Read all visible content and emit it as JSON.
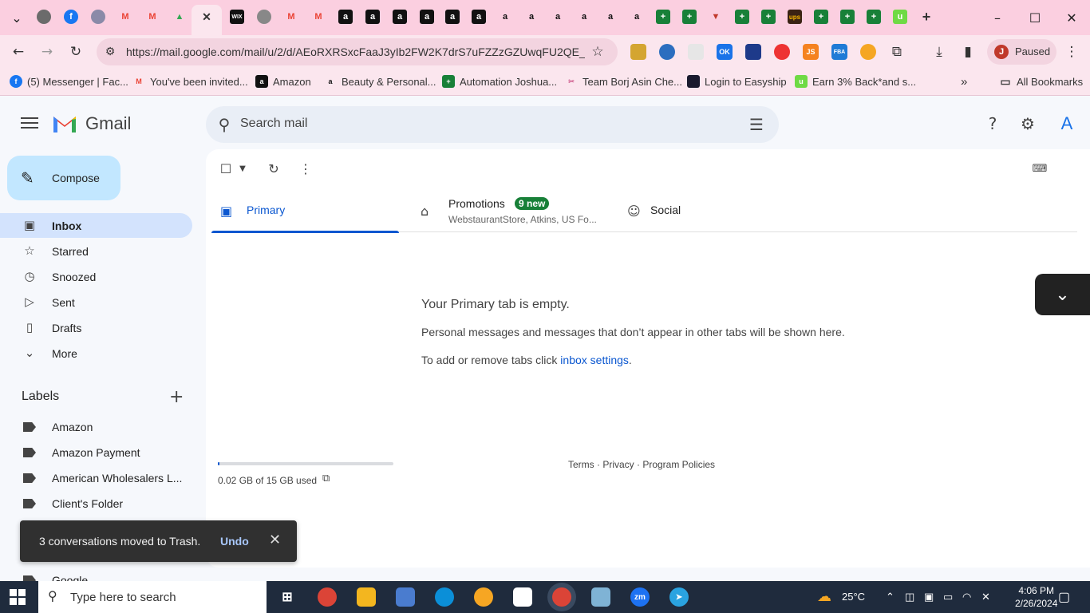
{
  "browser": {
    "tab_icons": [
      "chrome-icon",
      "facebook-icon",
      "web-icon",
      "gmail-icon",
      "gmail-icon",
      "drive-icon",
      "gmail-icon-active",
      "wix-icon",
      "globe-icon",
      "gmail-icon",
      "gmail-icon",
      "amazon-icon",
      "amazon-icon",
      "amazon-icon",
      "amazon-icon",
      "amazon-icon",
      "amazon-icon",
      "amazon-icon",
      "amazon-icon",
      "amazon-icon",
      "amazon-icon",
      "amazon-icon",
      "sheets-icon",
      "sheets-icon",
      "dropdown-icon",
      "sheets-icon",
      "sheets-icon",
      "ups-icon",
      "sheets-icon",
      "sheets-icon",
      "sheets-icon",
      "upwork-icon"
    ],
    "wix_label": "WIX",
    "ups_label": "ups",
    "url": "https://mail.google.com/mail/u/2/d/AEoRXRSxcFaaJ3yIb2FW2K7drS7uFZZzGZUwqFU2QE_I...",
    "profile_initial": "J",
    "profile_status": "Paused",
    "ext_labels": {
      "ok": "OK",
      "js": "JS",
      "fba": "FBA"
    },
    "bookmarks": [
      {
        "label": "(5) Messenger | Fac...",
        "icon": "facebook-icon",
        "color": "#1877f2"
      },
      {
        "label": "You've been invited...",
        "icon": "gmail-icon",
        "color": "#ea4335"
      },
      {
        "label": "Amazon",
        "icon": "amazon-icon",
        "color": "#111111"
      },
      {
        "label": "Beauty & Personal...",
        "icon": "amazon-icon",
        "color": "#111111"
      },
      {
        "label": "Automation Joshua...",
        "icon": "sheets-icon",
        "color": "#188038"
      },
      {
        "label": "Team Borj Asin Che...",
        "icon": "tool-icon",
        "color": "#d06090"
      },
      {
        "label": "Login to Easyship",
        "icon": "easyship-icon",
        "color": "#1a1a2e"
      },
      {
        "label": "Earn 3% Back*and s...",
        "icon": "upwork-icon",
        "color": "#6fda44"
      }
    ],
    "all_bookmarks": "All Bookmarks"
  },
  "gmail": {
    "app_name": "Gmail",
    "search_placeholder": "Search mail",
    "account_initial": "A",
    "compose": "Compose",
    "nav": [
      {
        "label": "Inbox",
        "icon": "inbox-icon",
        "active": true
      },
      {
        "label": "Starred",
        "icon": "star-icon"
      },
      {
        "label": "Snoozed",
        "icon": "clock-icon"
      },
      {
        "label": "Sent",
        "icon": "send-icon"
      },
      {
        "label": "Drafts",
        "icon": "draft-icon"
      },
      {
        "label": "More",
        "icon": "chevron-down-icon"
      }
    ],
    "labels_title": "Labels",
    "labels": [
      "Amazon",
      "Amazon Payment",
      "American Wholesalers L...",
      "Client's Folder",
      "Google"
    ],
    "tabs": [
      {
        "label": "Primary",
        "icon": "inbox-icon",
        "active": true
      },
      {
        "label": "Promotions",
        "icon": "tag-icon",
        "badge": "9 new",
        "subtitle": "WebstaurantStore, Atkins, US Fo..."
      },
      {
        "label": "Social",
        "icon": "people-icon"
      }
    ],
    "empty": {
      "title": "Your Primary tab is empty.",
      "desc": "Personal messages and messages that don’t appear in other tabs will be shown here.",
      "hint_prefix": "To add or remove tabs click ",
      "hint_link": "inbox settings",
      "hint_suffix": "."
    },
    "storage": {
      "text": "0.02 GB of 15 GB used",
      "fraction": 0.0013
    },
    "footer": "Terms · Privacy · Program Policies",
    "toast": {
      "message": "3 conversations moved to Trash.",
      "action": "Undo"
    }
  },
  "taskbar": {
    "search_placeholder": "Type here to search",
    "apps": [
      {
        "name": "task-view-icon",
        "color": "#1f2b3d"
      },
      {
        "name": "chrome-icon",
        "color": "#db4437"
      },
      {
        "name": "file-explorer-icon",
        "color": "#f3b61f"
      },
      {
        "name": "control-panel-icon",
        "color": "#4a7ccf"
      },
      {
        "name": "edge-icon",
        "color": "#0b8fd8"
      },
      {
        "name": "brave-icon",
        "color": "#f6a623"
      },
      {
        "name": "notepad-icon",
        "color": "#ffffff"
      },
      {
        "name": "chrome-active-icon",
        "color": "#db4437"
      },
      {
        "name": "note-icon",
        "color": "#7fb3d5"
      },
      {
        "name": "zoom-icon",
        "color": "#1d72f2"
      },
      {
        "name": "telegram-icon",
        "color": "#2aa3e0"
      }
    ],
    "zoom_label": "zm",
    "temperature": "25°C",
    "time": "4:06 PM",
    "date": "2/26/2024"
  }
}
